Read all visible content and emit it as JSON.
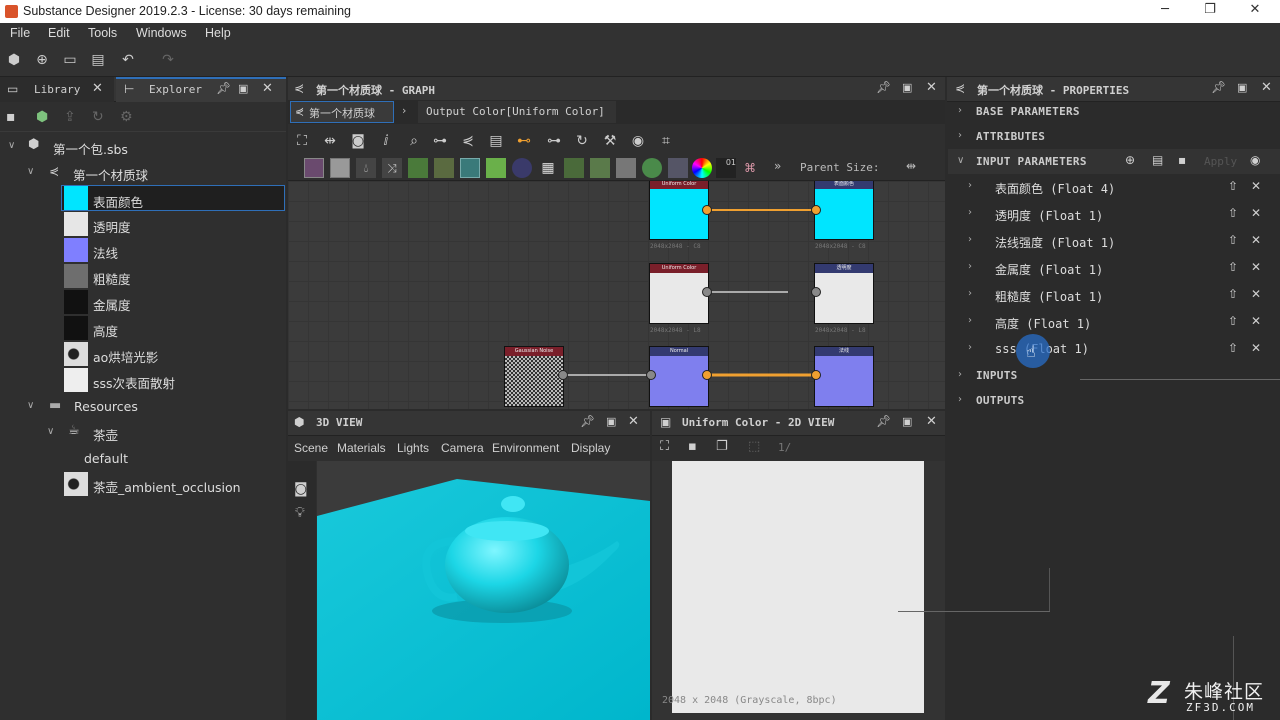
{
  "window": {
    "title": "Substance Designer 2019.2.3 - License: 30 days remaining",
    "minimize": "─",
    "restore": "❐",
    "close": "✕"
  },
  "menu": [
    "File",
    "Edit",
    "Tools",
    "Windows",
    "Help"
  ],
  "left_panel": {
    "tabs": [
      "Library",
      "Explorer"
    ],
    "tree": [
      {
        "label": "第一个包.sbs",
        "depth": 0,
        "icon": "package-icon"
      },
      {
        "label": "第一个材质球",
        "depth": 1,
        "icon": "graph-icon"
      },
      {
        "label": "表面颜色",
        "depth": 2,
        "swatch": "#00e5ff",
        "selected": true
      },
      {
        "label": "透明度",
        "depth": 2,
        "swatch": "#e6e6e6"
      },
      {
        "label": "法线",
        "depth": 2,
        "swatch": "#7f7fff"
      },
      {
        "label": "粗糙度",
        "depth": 2,
        "swatch": "#6e6e6e"
      },
      {
        "label": "金属度",
        "depth": 2,
        "swatch": "#111111"
      },
      {
        "label": "高度",
        "depth": 2,
        "swatch": "#111111"
      },
      {
        "label": "ao烘培光影",
        "depth": 2,
        "swatch": "bitmap"
      },
      {
        "label": "sss次表面散射",
        "depth": 2,
        "swatch": "#eeeeee"
      },
      {
        "label": "Resources",
        "depth": 1,
        "icon": "folder-icon"
      },
      {
        "label": "茶壶",
        "depth": 2,
        "icon": "mesh-icon"
      },
      {
        "label": "default",
        "depth": 3
      },
      {
        "label": "茶壶_ambient_occlusion",
        "depth": 2,
        "swatch": "bitmap"
      }
    ]
  },
  "graph": {
    "title": "第一个材质球 - GRAPH",
    "breadcrumb_root": "第一个材质球",
    "breadcrumb_child": "Output Color[Uniform Color]",
    "parent_size_label": "Parent Size:",
    "nodes": [
      {
        "header": "Uniform Color",
        "footer": "2048x2048 - C8"
      },
      {
        "header": "表面颜色",
        "footer": "2048x2048 - C8"
      },
      {
        "header": "Uniform Color",
        "footer": "2048x2048 - L8"
      },
      {
        "header": "透明度",
        "footer": "2048x2048 - L8"
      },
      {
        "header": "Gaussian Noise",
        "footer": ""
      },
      {
        "header": "Normal",
        "footer": ""
      },
      {
        "header": "法线",
        "footer": ""
      }
    ]
  },
  "view3d": {
    "title": "3D VIEW",
    "menus": [
      "Scene",
      "Materials",
      "Lights",
      "Camera",
      "Environment",
      "Display"
    ]
  },
  "view2d": {
    "title": "Uniform Color - 2D VIEW",
    "zoom": "1/",
    "status": "2048 x 2048 (Grayscale, 8bpc)"
  },
  "properties": {
    "title": "第一个材质球 - PROPERTIES",
    "sections": [
      "BASE PARAMETERS",
      "ATTRIBUTES",
      "INPUT PARAMETERS",
      "INPUTS",
      "OUTPUTS"
    ],
    "apply_label": "Apply",
    "params": [
      "表面颜色 (Float 4)",
      "透明度 (Float 1)",
      "法线强度 (Float 1)",
      "金属度 (Float 1)",
      "粗糙度 (Float 1)",
      "高度 (Float 1)",
      "sss (Float 1)"
    ]
  },
  "watermark": {
    "brand": "朱峰社区",
    "site": "ZF3D.COM"
  },
  "colors": {
    "accent_orange": "#f0a030",
    "selection_blue": "#2f6fb8",
    "cyan": "#00e5ff"
  }
}
